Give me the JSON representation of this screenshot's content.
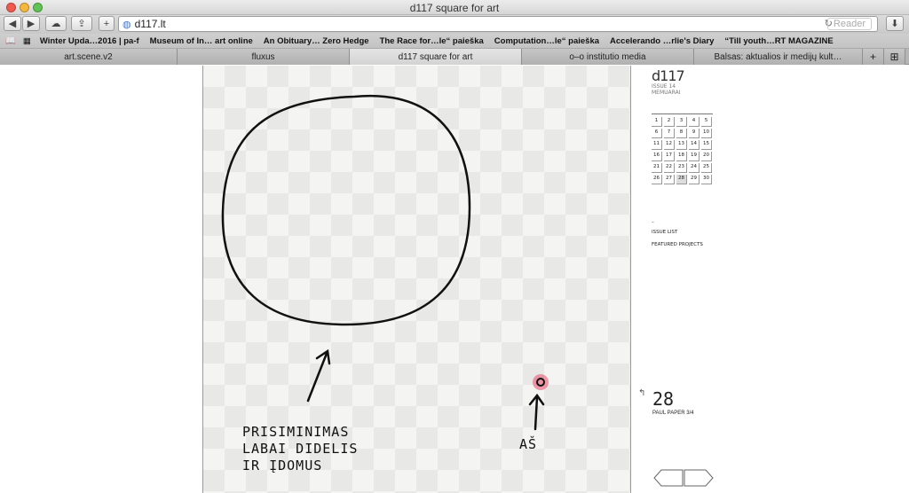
{
  "window": {
    "title": "d117 square for art"
  },
  "address_bar": {
    "url": "d117.lt",
    "reader_label": "Reader"
  },
  "bookmarks": [
    "Winter Upda…2016 | pa-f",
    "Museum of In… art online",
    "An Obituary… Zero Hedge",
    "The Race for…le“ paieška",
    "Computation…le“ paieška",
    "Accelerando …rlie's Diary",
    "“Till youth…RT MAGAZINE"
  ],
  "tabs": [
    {
      "label": "art.scene.v2",
      "active": false
    },
    {
      "label": "fluxus",
      "active": false
    },
    {
      "label": "d117 square for art",
      "active": true
    },
    {
      "label": "o–o institutio media",
      "active": false
    },
    {
      "label": "Balsas: aktualios ir medijų kult…",
      "active": false
    }
  ],
  "artwork": {
    "text_memory": [
      "PRISIMINIMAS",
      "LABAI DIDELIS",
      "IR ĮDOMUS"
    ],
    "text_me": "AŠ"
  },
  "sidebar": {
    "logo": "d117",
    "issue_label": "ISSUE 14",
    "issue_sub": "MEMUARAI",
    "days": [
      "1",
      "2",
      "3",
      "4",
      "5",
      "6",
      "7",
      "8",
      "9",
      "10",
      "11",
      "12",
      "13",
      "14",
      "15",
      "16",
      "17",
      "18",
      "19",
      "20",
      "21",
      "22",
      "23",
      "24",
      "25",
      "26",
      "27",
      "28",
      "29",
      "30"
    ],
    "dash": "–",
    "issue_list": "ISSUE LIST",
    "featured": "FEATURED PROJECTS",
    "issue_number": "28",
    "paper_label": "PAUL PAPER 3/4"
  },
  "colors": {
    "accent_red": "#d9143a"
  }
}
